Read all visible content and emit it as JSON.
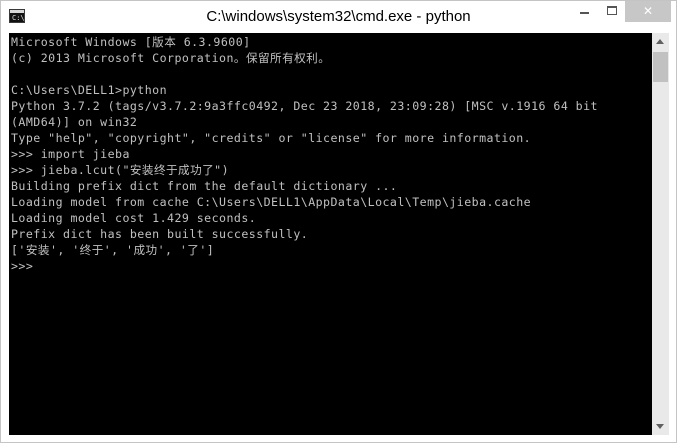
{
  "window": {
    "title": "C:\\windows\\system32\\cmd.exe - python",
    "icon": "console-icon",
    "icon_glyph": "C:\\",
    "close_glyph": "✕"
  },
  "console": {
    "lines": [
      "Microsoft Windows [版本 6.3.9600]",
      "(c) 2013 Microsoft Corporation。保留所有权利。",
      "",
      "C:\\Users\\DELL1>python",
      "Python 3.7.2 (tags/v3.7.2:9a3ffc0492, Dec 23 2018, 23:09:28) [MSC v.1916 64 bit",
      "(AMD64)] on win32",
      "Type \"help\", \"copyright\", \"credits\" or \"license\" for more information.",
      ">>> import jieba",
      ">>> jieba.lcut(\"安装终于成功了\")",
      "Building prefix dict from the default dictionary ...",
      "Loading model from cache C:\\Users\\DELL1\\AppData\\Local\\Temp\\jieba.cache",
      "Loading model cost 1.429 seconds.",
      "Prefix dict has been built successfully.",
      "['安装', '终于', '成功', '了']",
      ">>>"
    ],
    "text_color": "#c0c0c0",
    "background": "#000000"
  }
}
